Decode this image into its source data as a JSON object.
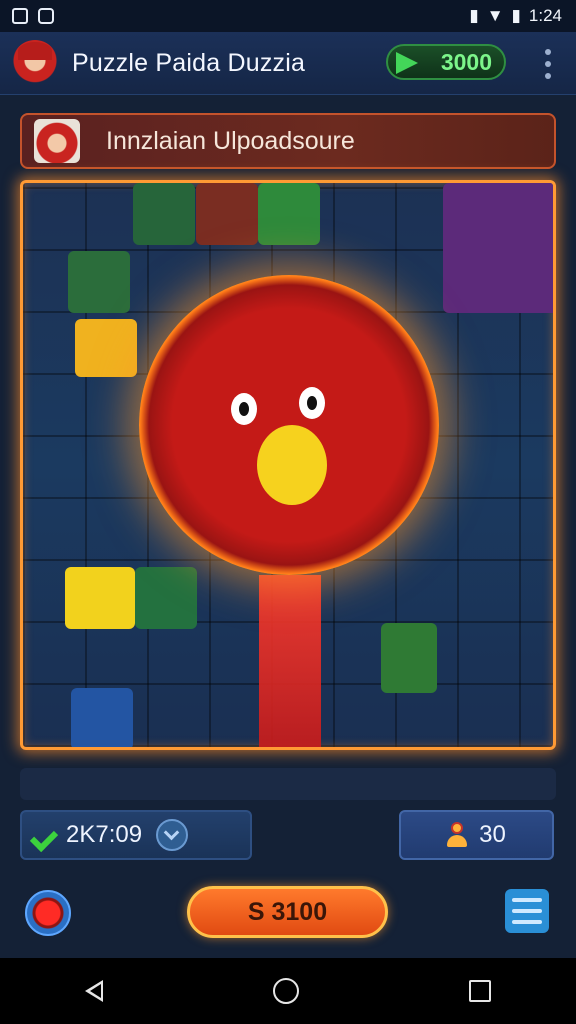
{
  "status_bar": {
    "time": "1:24"
  },
  "header": {
    "title": "Puzzle Paida Duzzia",
    "coins": "3000"
  },
  "banner": {
    "text": "Innzlaian Ulpoadsoure"
  },
  "stats": {
    "timer": "2K7:09",
    "players": "30"
  },
  "action": {
    "price": "S 3100"
  },
  "colors": {
    "accent": "#ff9a34",
    "coin_green": "#43d659",
    "button_orange": "#e14a12"
  },
  "icons": [
    "image-icon",
    "cloud-icon",
    "wifi-icon",
    "battery-icon",
    "avatar-icon",
    "arrow-icon",
    "more-icon",
    "check-icon",
    "timer-icon",
    "player-icon",
    "record-icon",
    "menu-icon",
    "back-icon",
    "home-icon",
    "recents-icon"
  ]
}
